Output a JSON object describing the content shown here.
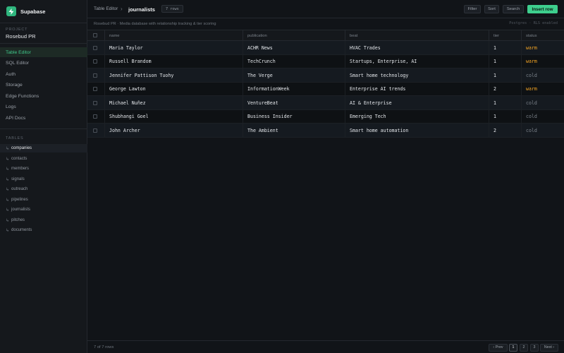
{
  "brand": {
    "name": "Supabase"
  },
  "project": {
    "label": "PROJECT",
    "name": "Rosebud PR"
  },
  "nav": [
    {
      "label": "Table Editor",
      "active": true
    },
    {
      "label": "SQL Editor"
    },
    {
      "label": "Auth"
    },
    {
      "label": "Storage"
    },
    {
      "label": "Edge Functions"
    },
    {
      "label": "Logs"
    },
    {
      "label": "API Docs"
    }
  ],
  "tables": {
    "label": "TABLES",
    "items": [
      {
        "label": "companies",
        "active": true
      },
      {
        "label": "contacts"
      },
      {
        "label": "members"
      },
      {
        "label": "signals"
      },
      {
        "label": "outreach"
      },
      {
        "label": "pipelines"
      },
      {
        "label": "journalists"
      },
      {
        "label": "pitches"
      },
      {
        "label": "documents"
      }
    ]
  },
  "topbar": {
    "breadcrumb_root": "Table Editor",
    "chevron": "›",
    "table_name": "journalists",
    "row_count": "7 rows",
    "filter": "Filter",
    "sort": "Sort",
    "search": "Search",
    "insert": "Insert row"
  },
  "subbar": {
    "description": "Rosebud PR · Media database with relationship tracking & tier scoring",
    "tags": "Postgres · RLS enabled"
  },
  "columns": [
    "name",
    "publication",
    "beat",
    "tier",
    "status"
  ],
  "rows": [
    {
      "name": "Maria Taylor",
      "publication": "ACHR News",
      "beat": "HVAC Trades",
      "tier": "1",
      "status": "warm"
    },
    {
      "name": "Russell Brandom",
      "publication": "TechCrunch",
      "beat": "Startups, Enterprise, AI",
      "tier": "1",
      "status": "warm"
    },
    {
      "name": "Jennifer Pattison Tuohy",
      "publication": "The Verge",
      "beat": "Smart home technology",
      "tier": "1",
      "status": "cold"
    },
    {
      "name": "George Lawton",
      "publication": "InformationWeek",
      "beat": "Enterprise AI trends",
      "tier": "2",
      "status": "warm"
    },
    {
      "name": "Michael Nuñez",
      "publication": "VentureBeat",
      "beat": "AI & Enterprise",
      "tier": "1",
      "status": "cold"
    },
    {
      "name": "Shubhangi Goel",
      "publication": "Business Insider",
      "beat": "Emerging Tech",
      "tier": "1",
      "status": "cold"
    },
    {
      "name": "John Archer",
      "publication": "The Ambient",
      "beat": "Smart home automation",
      "tier": "2",
      "status": "cold"
    }
  ],
  "footer": {
    "count": "7 of 7 rows",
    "prev": "‹ Prev",
    "pages": [
      "1",
      "2",
      "3"
    ],
    "next": "Next ›"
  },
  "colors": {
    "accent": "#3ecf8e",
    "warm": "#f5a524",
    "cold": "#7e858d"
  }
}
